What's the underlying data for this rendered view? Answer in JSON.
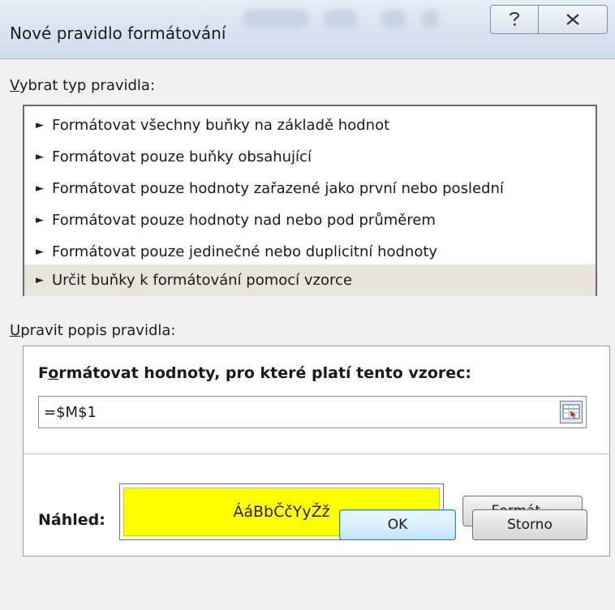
{
  "window": {
    "title": "Nové pravidlo formátování",
    "help_icon": "question-icon",
    "close_icon": "close-icon"
  },
  "rule_type": {
    "label_accel": "V",
    "label_rest": "ybrat typ pravidla:",
    "items": [
      {
        "label": "Formátovat všechny buňky na základě hodnot"
      },
      {
        "label": "Formátovat pouze buňky obsahující"
      },
      {
        "label": "Formátovat pouze hodnoty zařazené jako první nebo poslední"
      },
      {
        "label": "Formátovat pouze hodnoty nad nebo pod průměrem"
      },
      {
        "label": "Formátovat pouze jedinečné nebo duplicitní hodnoty"
      },
      {
        "label": "Určit buňky k formátování pomocí vzorce",
        "selected": true
      }
    ],
    "arrow_glyph": "►"
  },
  "description": {
    "label_accel": "U",
    "label_rest": "pravit popis pravidla:",
    "formula_label_pre": "F",
    "formula_label_accel": "o",
    "formula_label_rest": "rmátovat hodnoty, pro které platí tento vzorec:",
    "formula_value": "=$M$1",
    "ref_icon": "range-select-icon",
    "preview_label": "Náhled:",
    "preview_text": "ÁáBbČčYyŽž",
    "preview_fill": "#ffff00",
    "format_button_accel": "F",
    "format_button_rest": "ormát..."
  },
  "footer": {
    "ok_label": "OK",
    "cancel_label": "Storno"
  }
}
